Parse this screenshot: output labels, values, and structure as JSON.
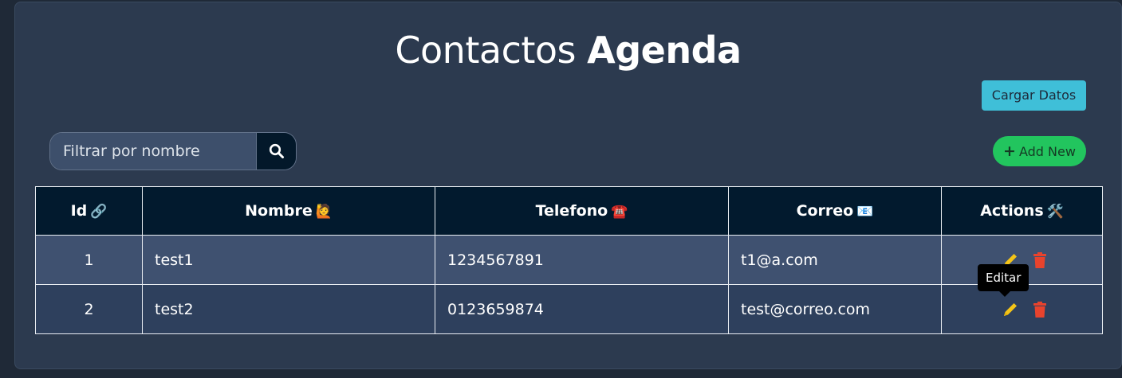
{
  "header": {
    "title_light": "Contactos",
    "title_bold": "Agenda"
  },
  "toolbar": {
    "load_label": "Cargar Datos",
    "add_label": "Add New",
    "add_icon": "plus-icon"
  },
  "search": {
    "placeholder": "Filtrar por nombre",
    "value": "",
    "icon": "search-icon"
  },
  "table": {
    "columns": [
      {
        "label": "Id",
        "emoji": "🔗"
      },
      {
        "label": "Nombre",
        "emoji": "🙋"
      },
      {
        "label": "Telefono",
        "emoji": "☎️"
      },
      {
        "label": "Correo",
        "emoji": "📧"
      },
      {
        "label": "Actions",
        "emoji": "🛠️"
      }
    ],
    "rows": [
      {
        "id": "1",
        "nombre": "test1",
        "telefono": "1234567891",
        "correo": "t1@a.com"
      },
      {
        "id": "2",
        "nombre": "test2",
        "telefono": "0123659874",
        "correo": "test@correo.com"
      }
    ]
  },
  "tooltip": {
    "text": "Editar"
  },
  "colors": {
    "edit_icon": "#f5c518",
    "delete_icon": "#e8432d",
    "add_button": "#22c55e",
    "load_button": "#3fbfd8"
  }
}
